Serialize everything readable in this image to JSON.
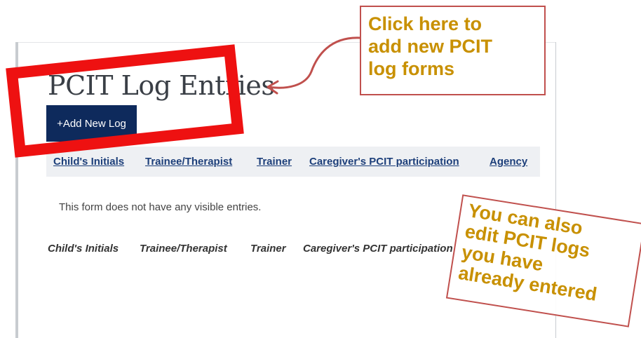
{
  "page": {
    "title": "PCIT Log Entries",
    "add_button_label": "+Add New Log",
    "header_columns": [
      "Child's Initials",
      "Trainee/Therapist",
      "Trainer",
      "Caregiver's PCIT participation",
      "Agency"
    ],
    "empty_message": "This form does not have any visible entries.",
    "footer_columns": [
      "Child's Initials",
      "Trainee/Therapist",
      "Trainer",
      "Caregiver's PCIT participation"
    ]
  },
  "annotations": {
    "top_callout": [
      "Click here to",
      "add new PCIT",
      "log forms"
    ],
    "bottom_callout": [
      "You can also",
      "edit PCIT logs",
      "you have",
      "already entered"
    ]
  },
  "colors": {
    "highlight_red": "#ee1111",
    "callout_text": "#c89000",
    "callout_border": "#c0504d",
    "button_navy": "#0e2a5c",
    "link_blue": "#1d3f7a"
  }
}
